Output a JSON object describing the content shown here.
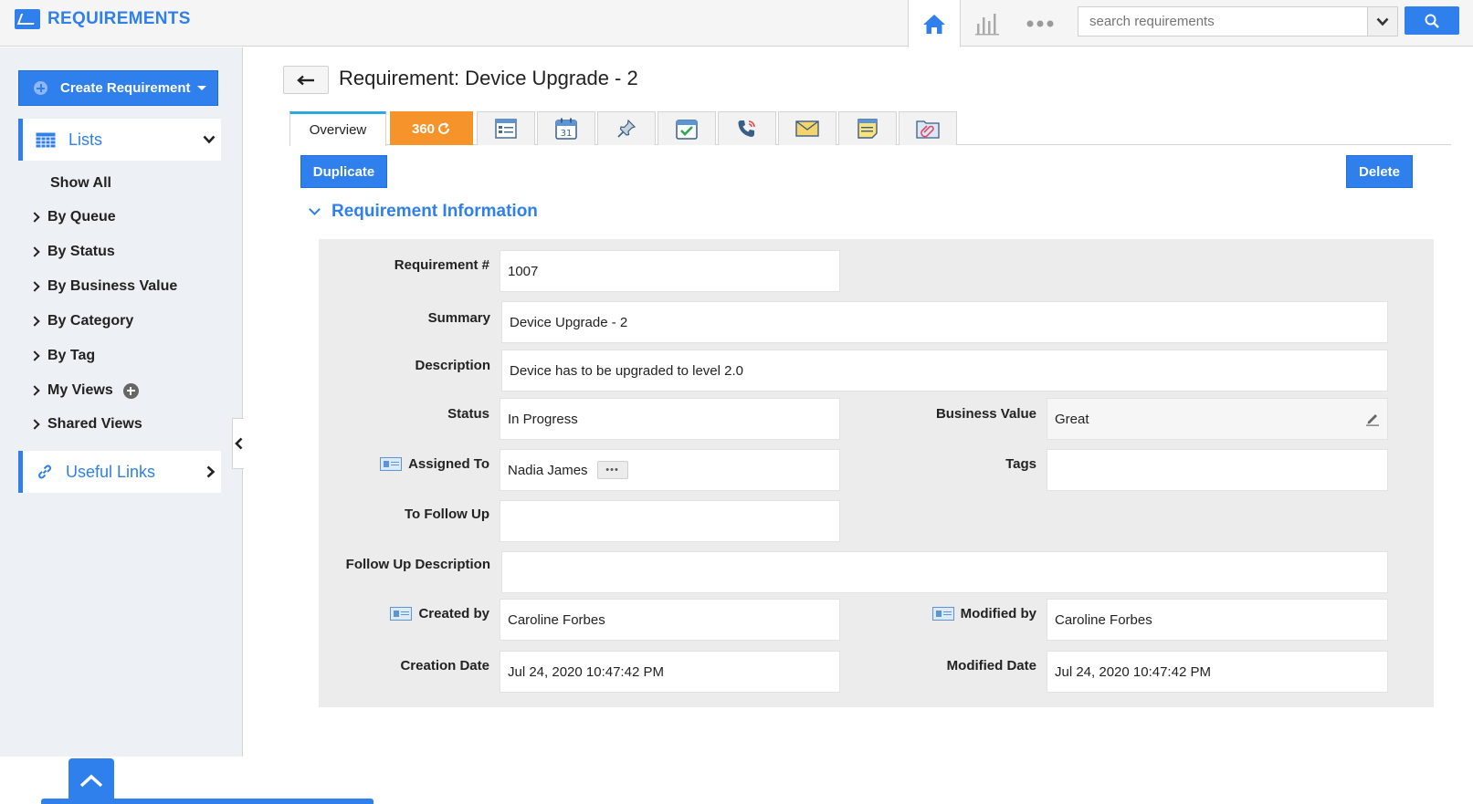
{
  "app": {
    "title": "REQUIREMENTS"
  },
  "header": {
    "search": {
      "placeholder": "search requirements"
    },
    "icons": [
      "home-icon",
      "chart-icon",
      "more-icon",
      "chevron-down-icon",
      "search-icon"
    ]
  },
  "sidebar": {
    "create_label": "Create Requirement",
    "lists_label": "Lists",
    "items": [
      {
        "label": "Show All"
      },
      {
        "label": "By Queue"
      },
      {
        "label": "By Status"
      },
      {
        "label": "By Business Value"
      },
      {
        "label": "By Category"
      },
      {
        "label": "By Tag"
      },
      {
        "label": "My Views"
      },
      {
        "label": "Shared Views"
      }
    ],
    "links_label": "Useful Links"
  },
  "page": {
    "title": "Requirement: Device Upgrade - 2",
    "tabs": {
      "overview": "Overview",
      "t360": "360",
      "icons": [
        "details-icon",
        "calendar-icon",
        "pin-icon",
        "task-icon",
        "phone-icon",
        "mail-icon",
        "note-icon",
        "attachment-icon"
      ],
      "calendar_day": "31"
    },
    "duplicate_label": "Duplicate",
    "delete_label": "Delete",
    "section_title": "Requirement Information"
  },
  "fields": {
    "requirement_no": {
      "label": "Requirement #",
      "value": "1007"
    },
    "summary": {
      "label": "Summary",
      "value": "Device Upgrade - 2"
    },
    "description": {
      "label": "Description",
      "value": "Device has to be upgraded to level 2.0"
    },
    "status": {
      "label": "Status",
      "value": "In Progress"
    },
    "business_value": {
      "label": "Business Value",
      "value": "Great"
    },
    "assigned_to": {
      "label": "Assigned To",
      "value": "Nadia James"
    },
    "tags": {
      "label": "Tags",
      "value": ""
    },
    "to_follow_up": {
      "label": "To Follow Up",
      "value": ""
    },
    "follow_up_description": {
      "label": "Follow Up Description",
      "value": ""
    },
    "created_by": {
      "label": "Created by",
      "value": "Caroline Forbes"
    },
    "modified_by": {
      "label": "Modified by",
      "value": "Caroline Forbes"
    },
    "creation_date": {
      "label": "Creation Date",
      "value": "Jul 24, 2020 10:47:42 PM"
    },
    "modified_date": {
      "label": "Modified Date",
      "value": "Jul 24, 2020 10:47:42 PM"
    }
  },
  "colors": {
    "accent": "#2f80ed",
    "tab360": "#f7932b",
    "panel": "#ececec",
    "sidebar": "#edf0f4"
  }
}
